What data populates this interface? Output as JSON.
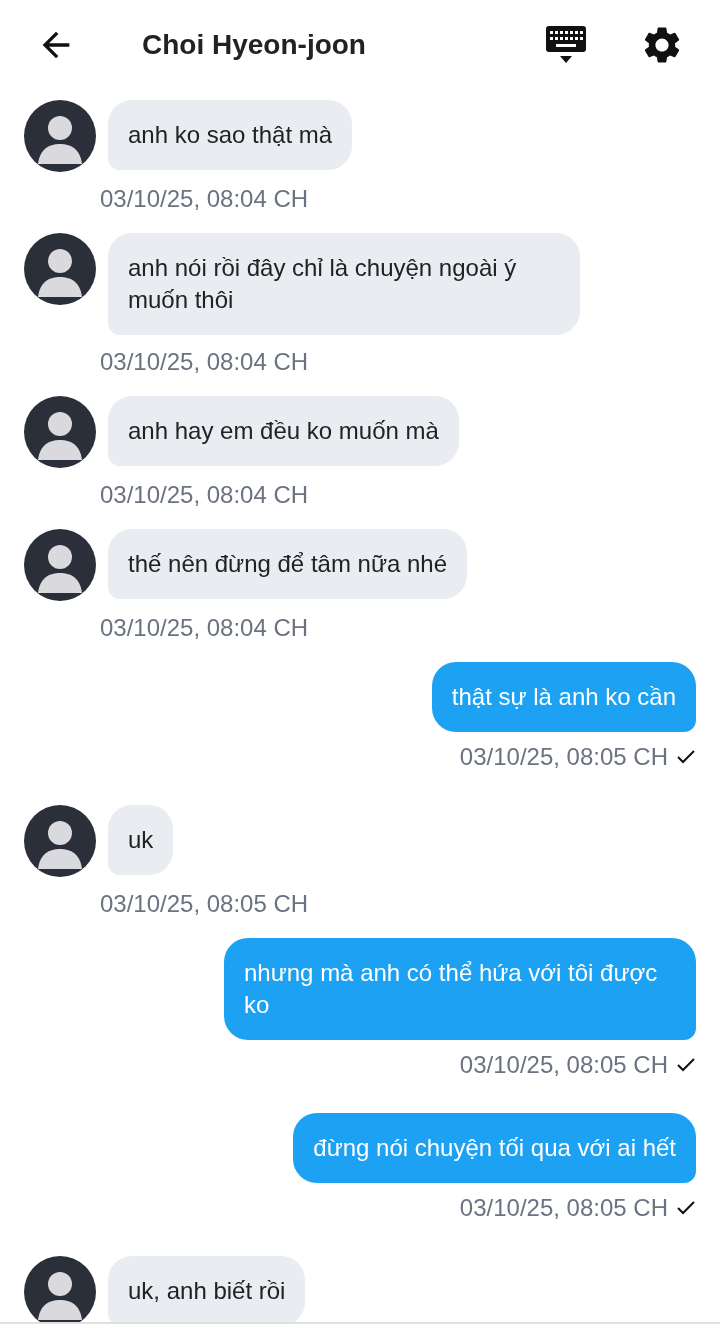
{
  "header": {
    "title": "Choi Hyeon-joon"
  },
  "messages": [
    {
      "kind": "received",
      "text": "anh ko sao thật mà",
      "time": "03/10/25, 08:04 CH"
    },
    {
      "kind": "received",
      "text": "anh nói rồi đây chỉ là chuyện ngoài ý muốn thôi",
      "time": "03/10/25, 08:04 CH"
    },
    {
      "kind": "received",
      "text": "anh hay em đều ko muốn mà",
      "time": "03/10/25, 08:04 CH"
    },
    {
      "kind": "received",
      "text": "thế nên đừng để tâm nữa nhé",
      "time": "03/10/25, 08:04 CH"
    },
    {
      "kind": "sent",
      "text": "thật sự là anh ko cần",
      "time": "03/10/25, 08:05 CH",
      "delivered": true
    },
    {
      "kind": "received",
      "text": "uk",
      "time": "03/10/25, 08:05 CH"
    },
    {
      "kind": "sent",
      "text": "nhưng mà anh có thể hứa với tôi được ko",
      "time": "03/10/25, 08:05 CH",
      "delivered": true
    },
    {
      "kind": "sent",
      "text": "đừng nói chuyện tối qua với ai hết",
      "time": "03/10/25, 08:05 CH",
      "delivered": true
    },
    {
      "kind": "received",
      "text": "uk, anh biết rồi"
    }
  ]
}
